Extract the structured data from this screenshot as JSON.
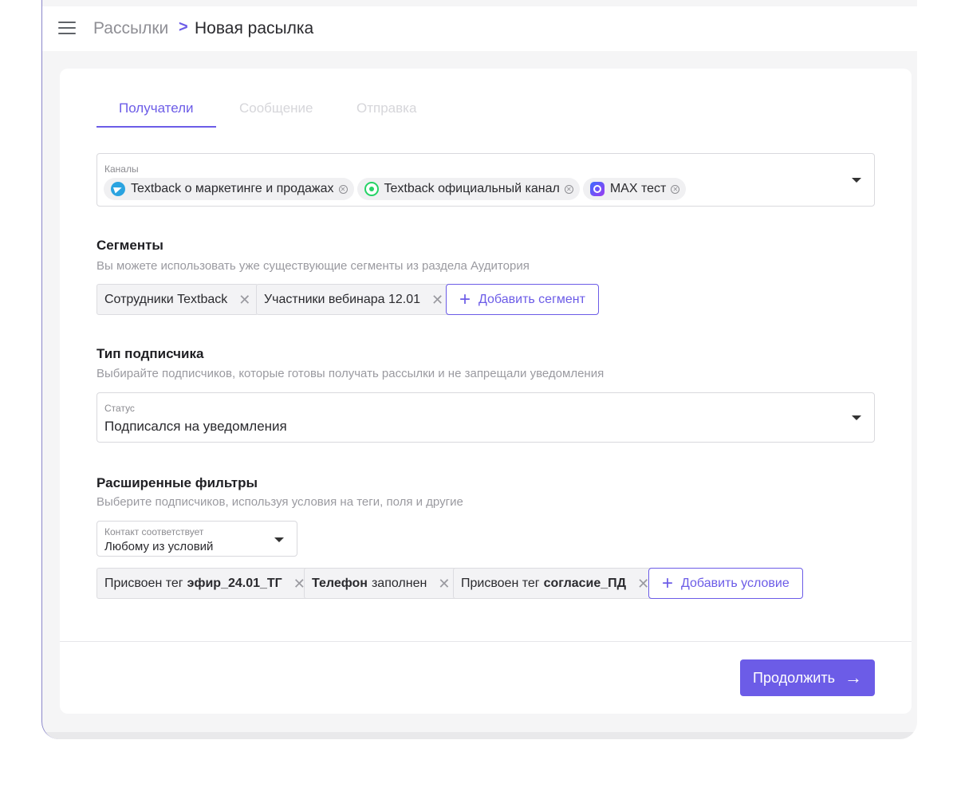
{
  "header": {
    "breadcrumb_parent": "Рассылки",
    "breadcrumb_separator": ">",
    "breadcrumb_current": "Новая расылка"
  },
  "tabs": [
    {
      "label": "Получатели",
      "state": "active"
    },
    {
      "label": "Сообщение",
      "state": "disabled"
    },
    {
      "label": "Отправка",
      "state": "disabled"
    }
  ],
  "channels": {
    "label": "Каналы",
    "selected": [
      {
        "name": "Textback о маркетинге и продажах",
        "icon": "telegram-icon"
      },
      {
        "name": "Textback официальный канал",
        "icon": "whatsapp-icon"
      },
      {
        "name": "MAX тест",
        "icon": "max-icon"
      }
    ]
  },
  "segments": {
    "title": "Сегменты",
    "hint": "Вы можете использовать уже существующие сегменты из раздела Аудитория",
    "items": [
      "Сотрудники Textback",
      "Участники вебинара 12.01"
    ],
    "add_label": "Добавить сегмент"
  },
  "subscriber_type": {
    "title": "Тип подписчика",
    "hint": "Выбирайте подписчиков, которые готовы получать рассылки и не запрещали уведомления",
    "status_label": "Статус",
    "status_value": "Подписался на уведомления"
  },
  "filters": {
    "title": "Расширенные фильтры",
    "hint": "Выберите подписчиков, используя условия на теги, поля и другие",
    "match_label": "Контакт соответствует",
    "match_value": "Любому из условий",
    "conditions": [
      {
        "prefix": "Присвоен тег",
        "bold": "эфир_24.01_ТГ",
        "suffix": ""
      },
      {
        "prefix": "",
        "bold": "Телефон",
        "suffix": "заполнен"
      },
      {
        "prefix": "Присвоен тег",
        "bold": "согласие_ПД",
        "suffix": ""
      }
    ],
    "add_label": "Добавить условие"
  },
  "footer": {
    "continue_label": "Продолжить"
  },
  "colors": {
    "accent": "#6c5ce7",
    "telegram": "#2aa3e0",
    "whatsapp": "#25d366"
  }
}
